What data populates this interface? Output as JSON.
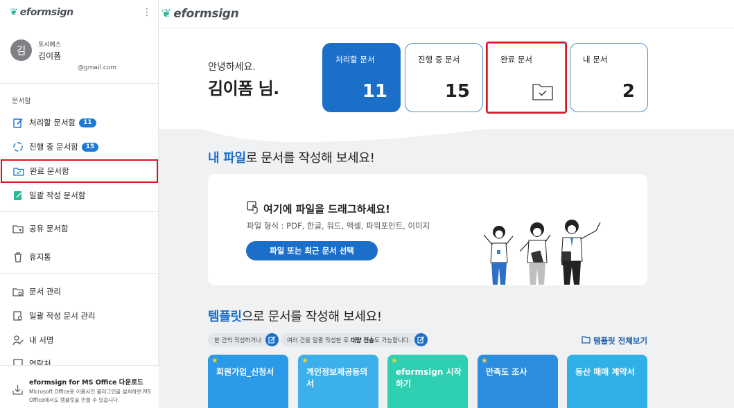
{
  "brand": {
    "name": "eformsign"
  },
  "sidebar": {
    "menu_icon": "more-vertical-icon",
    "user": {
      "avatar_initial": "김",
      "org": "포시에스",
      "name": "김이폼",
      "email": "@gmail.com"
    },
    "section_label": "문서함",
    "items": [
      {
        "label": "처리할 문서함",
        "badge": "11",
        "icon": "edit-doc-icon"
      },
      {
        "label": "진행 중 문서함",
        "badge": "15",
        "icon": "progress-cycle-icon"
      },
      {
        "label": "완료 문서함",
        "icon": "done-folder-icon",
        "active": true
      },
      {
        "label": "일괄 작성 문서함",
        "icon": "bulk-doc-icon"
      },
      {
        "label": "공유 문서함",
        "icon": "share-folder-icon"
      },
      {
        "label": "휴지통",
        "icon": "trash-icon"
      },
      {
        "label": "문서 관리",
        "icon": "doc-manage-icon"
      },
      {
        "label": "일괄 작성 문서 관리",
        "icon": "bulk-manage-icon"
      },
      {
        "label": "내 서명",
        "icon": "signature-icon"
      },
      {
        "label": "연락처",
        "icon": "contacts-icon"
      }
    ],
    "download": {
      "title": "eformsign for MS Office 다운로드",
      "desc": "Microsoft Office용 이폼사인 플러그인을 설치하면 MS Office에서도 템플릿을 만들 수 있습니다."
    }
  },
  "hero": {
    "greeting": "안녕하세요.",
    "username": "김이폼 님.",
    "cards": [
      {
        "label": "처리할 문서",
        "value": "11"
      },
      {
        "label": "진행 중 문서",
        "value": "15"
      },
      {
        "label": "완료 문서",
        "value": "",
        "icon": "done-folder-icon"
      },
      {
        "label": "내 문서",
        "value": "2"
      }
    ]
  },
  "upload_section": {
    "title_highlight": "내 파일",
    "title_rest": "로 문서를 작성해 보세요!",
    "drop_title": "여기에 파일을 드래그하세요!",
    "drop_sub": "파일 형식 : PDF, 한글, 워드, 엑셀, 파워포인트, 이미지",
    "button": "파일 또는 최근 문서 선택"
  },
  "template_section": {
    "title_highlight": "템플릿",
    "title_rest": "으로 문서를 작성해 보세요!",
    "pill1": "한 건씩 작성하거나",
    "pill2_pre": "여러 건을 일괄 작성한 후",
    "pill2_bold": "대량 전송",
    "pill2_post": "도 가능합니다.",
    "view_all": "템플릿 전체보기",
    "templates": [
      {
        "name": "회원가입_신청서",
        "starred": true,
        "color": "#2b9ae8"
      },
      {
        "name": "개인정보제공동의서",
        "starred": true,
        "color": "#3bb0ea"
      },
      {
        "name": "eformsign 시작하기",
        "starred": true,
        "color": "#2fcfb1"
      },
      {
        "name": "만족도 조사",
        "starred": true,
        "color": "#2b8ee0"
      },
      {
        "name": "동산 매매 계약서",
        "starred": false,
        "color": "#2fb1e8"
      }
    ]
  }
}
